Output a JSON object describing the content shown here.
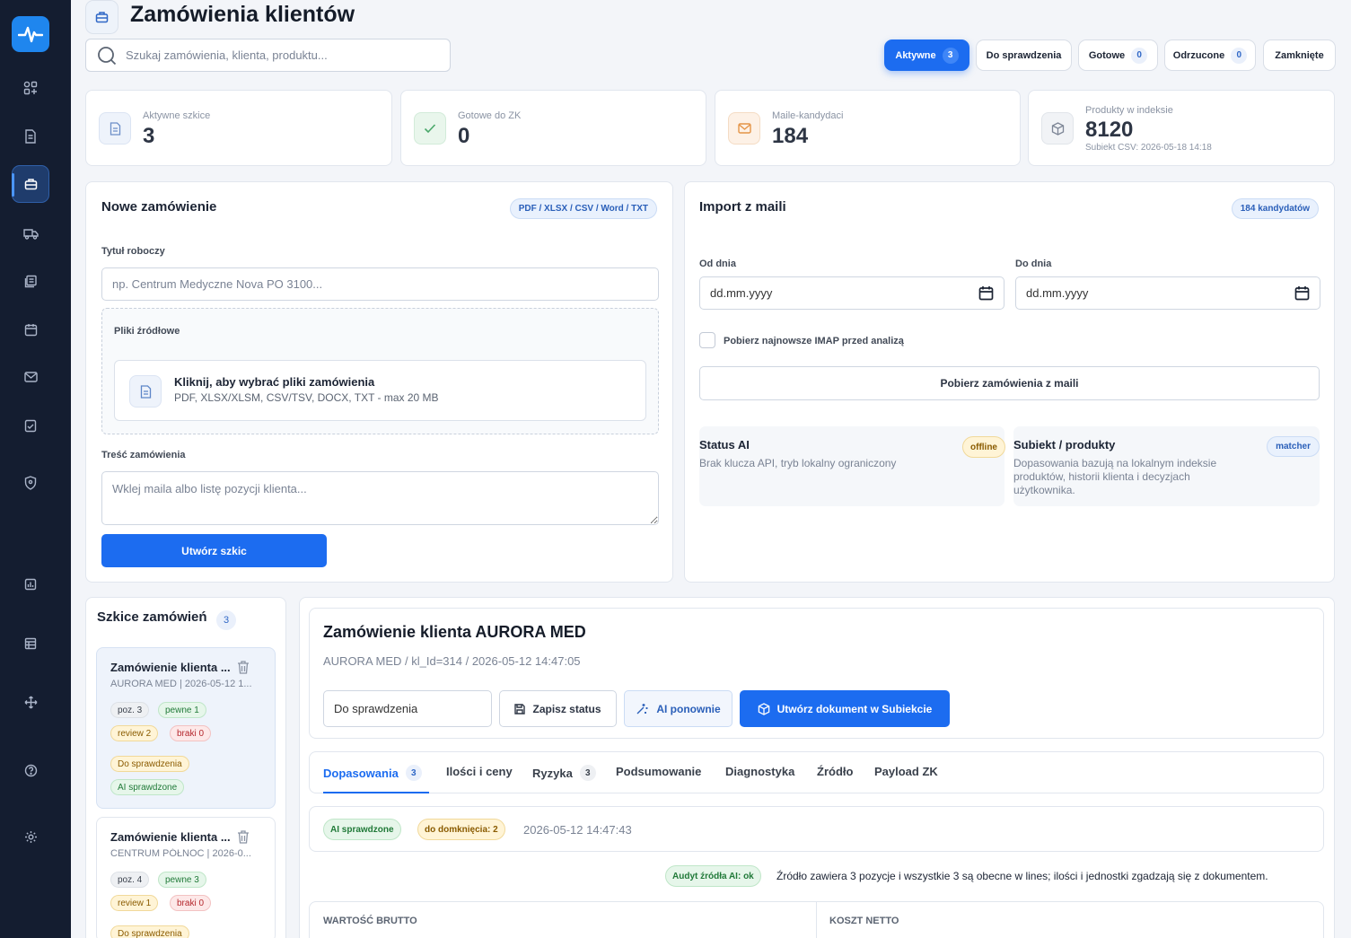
{
  "header": {
    "title": "Zamówienia klientów",
    "search_placeholder": "Szukaj zamówienia, klienta, produktu..."
  },
  "filters": [
    {
      "label": "Aktywne",
      "count": "3",
      "active": true
    },
    {
      "label": "Do sprawdzenia",
      "count": ""
    },
    {
      "label": "Gotowe",
      "count": "0"
    },
    {
      "label": "Odrzucone",
      "count": "0"
    },
    {
      "label": "Zamknięte",
      "count": ""
    }
  ],
  "stats": [
    {
      "label": "Aktywne szkice",
      "value": "3",
      "icon": "document-icon"
    },
    {
      "label": "Gotowe do ZK",
      "value": "0",
      "icon": "check-icon"
    },
    {
      "label": "Maile-kandydaci",
      "value": "184",
      "icon": "mail-icon"
    },
    {
      "label": "Produkty w indeksie",
      "value": "8120",
      "sub": "Subiekt CSV: 2026-05-18 14:18",
      "icon": "box-icon"
    }
  ],
  "new_order": {
    "title": "Nowe zamówienie",
    "formats_badge": "PDF / XLSX / CSV / Word / TXT",
    "title_label": "Tytuł roboczy",
    "title_placeholder": "np. Centrum Medyczne Nova PO 3100...",
    "files_label": "Pliki źródłowe",
    "upload_main": "Kliknij, aby wybrać pliki zamówienia",
    "upload_sub": "PDF, XLSX/XLSM, CSV/TSV, DOCX, TXT - max 20 MB",
    "content_label": "Treść zamówienia",
    "content_placeholder": "Wklej maila albo listę pozycji klienta...",
    "create_button": "Utwórz szkic"
  },
  "mail_import": {
    "title": "Import z maili",
    "badge": "184 kandydatów",
    "from_label": "Od dnia",
    "from_value": "dd.mm.yyyy",
    "to_label": "Do dnia",
    "to_value": "dd.mm.yyyy",
    "imap_label": "Pobierz najnowsze IMAP przed analizą",
    "fetch_button": "Pobierz zamówienia z maili",
    "ai_status_title": "Status AI",
    "ai_status_badge": "offline",
    "ai_status_text": "Brak klucza API, tryb lokalny ograniczony",
    "subiekt_title": "Subiekt / produkty",
    "subiekt_badge": "matcher",
    "subiekt_text": "Dopasowania bazują na lokalnym indeksie produktów, historii klienta i decyzjach użytkownika."
  },
  "drafts": {
    "title": "Szkice zamówień",
    "count": "3",
    "items": [
      {
        "title": "Zamówienie klienta ...",
        "sub": "AURORA MED | 2026-05-12 1...",
        "tags": [
          "poz. 3",
          "pewne 1",
          "review 2",
          "braki 0",
          "Do sprawdzenia",
          "AI sprawdzone"
        ]
      },
      {
        "title": "Zamówienie klienta ...",
        "sub": "CENTRUM PÓŁNOC | 2026-0...",
        "tags": [
          "poz. 4",
          "pewne 3",
          "review 1",
          "braki 0",
          "Do sprawdzenia"
        ]
      }
    ]
  },
  "detail": {
    "title": "Zamówienie klienta AURORA MED",
    "meta": "AURORA MED / kl_Id=314 / 2026-05-12 14:47:05",
    "status_value": "Do sprawdzenia",
    "save_status": "Zapisz status",
    "ai_again": "AI ponownie",
    "create_doc": "Utwórz dokument w Subiekcie",
    "tabs": [
      {
        "label": "Dopasowania",
        "count": "3"
      },
      {
        "label": "Ilości i ceny",
        "count": ""
      },
      {
        "label": "Ryzyka",
        "count": "3"
      },
      {
        "label": "Podsumowanie",
        "count": ""
      },
      {
        "label": "Diagnostyka",
        "count": ""
      },
      {
        "label": "Źródło",
        "count": ""
      },
      {
        "label": "Payload ZK",
        "count": ""
      }
    ],
    "ai_checked": "AI sprawdzone",
    "to_close": "do domknięcia: 2",
    "timestamp": "2026-05-12 14:47:43",
    "audit_badge": "Audyt źródła AI: ok",
    "audit_text": "Źródło zawiera 3 pozycje i wszystkie 3 są obecne w lines; ilości i jednostki zgadzają się z dokumentem.",
    "gross_label": "WARTOŚĆ BRUTTO",
    "net_label": "KOSZT NETTO"
  }
}
